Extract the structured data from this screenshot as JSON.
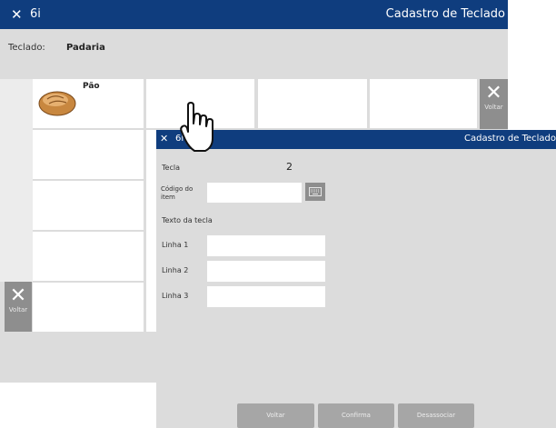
{
  "bg_window": {
    "close_glyph": "✕",
    "app_code": "6i",
    "title": "Cadastro de Teclado",
    "teclado_label": "Teclado:",
    "teclado_value": "Padaria",
    "key_label": "Pão",
    "voltar_label": "Voltar"
  },
  "dialog": {
    "close_glyph": "✕",
    "app_code": "6i",
    "title": "Cadastro de Teclado",
    "tecla_label": "Tecla",
    "tecla_value": "2",
    "codigo_label": "Código do item",
    "texto_label": "Texto da tecla",
    "linha1_label": "Linha 1",
    "linha2_label": "Linha 2",
    "linha3_label": "Linha 3",
    "codigo_value": "",
    "linha1_value": "",
    "linha2_value": "",
    "linha3_value": "",
    "buttons": {
      "voltar": "Voltar",
      "confirma": "Confirma",
      "desassociar": "Desassociar"
    }
  },
  "colors": {
    "titlebar": "#0f3d7e",
    "background": "#dcdcdc",
    "button": "#a6a6a6"
  },
  "icons": [
    "close-icon",
    "keyboard-icon",
    "hand-pointer-icon",
    "bread-icon"
  ]
}
